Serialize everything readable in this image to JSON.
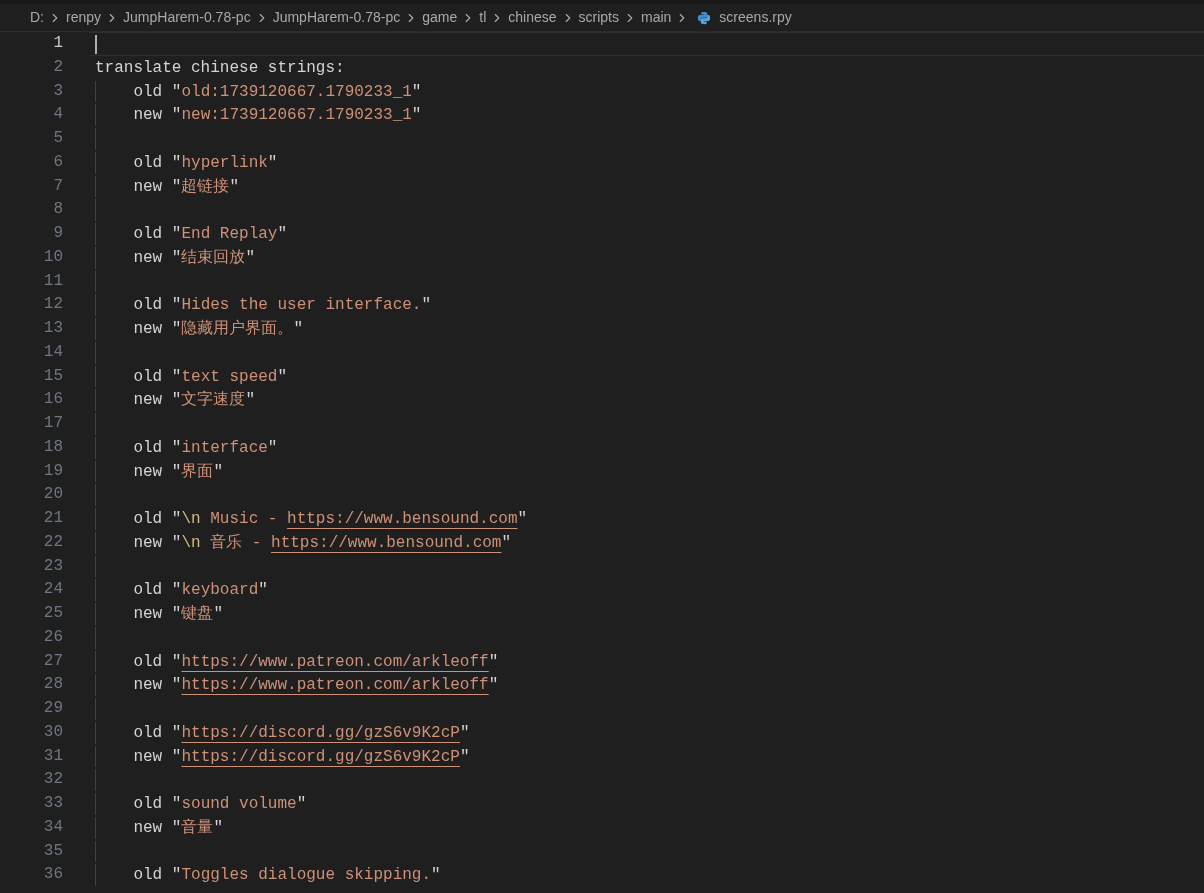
{
  "breadcrumb": [
    {
      "kind": "folder",
      "label": "D:"
    },
    {
      "kind": "folder",
      "label": "renpy"
    },
    {
      "kind": "folder",
      "label": "JumpHarem-0.78-pc"
    },
    {
      "kind": "folder",
      "label": "JumpHarem-0.78-pc"
    },
    {
      "kind": "folder",
      "label": "game"
    },
    {
      "kind": "folder",
      "label": "tl"
    },
    {
      "kind": "folder",
      "label": "chinese"
    },
    {
      "kind": "folder",
      "label": "scripts"
    },
    {
      "kind": "folder",
      "label": "main"
    },
    {
      "kind": "file",
      "label": "screens.rpy"
    }
  ],
  "lines": [
    {
      "number": "1",
      "current": true
    },
    {
      "number": "2",
      "current": false,
      "segments": [
        {
          "kind": "plain",
          "text": "translate chinese strings:"
        }
      ],
      "children": [
        {
          "number": "3",
          "current": false,
          "segments": [
            {
              "kind": "plain",
              "text": "old \""
            },
            {
              "kind": "string",
              "text": "old:1739120667.1790233_1"
            },
            {
              "kind": "plain",
              "text": "\""
            }
          ]
        },
        {
          "number": "4",
          "current": false,
          "segments": [
            {
              "kind": "plain",
              "text": "new \""
            },
            {
              "kind": "string",
              "text": "new:1739120667.1790233_1"
            },
            {
              "kind": "plain",
              "text": "\""
            }
          ]
        },
        {
          "number": "5",
          "current": false
        },
        {
          "number": "6",
          "current": false,
          "segments": [
            {
              "kind": "plain",
              "text": "old \""
            },
            {
              "kind": "string",
              "text": "hyperlink"
            },
            {
              "kind": "plain",
              "text": "\""
            }
          ]
        },
        {
          "number": "7",
          "current": false,
          "segments": [
            {
              "kind": "plain",
              "text": "new \""
            },
            {
              "kind": "string",
              "text": "超链接"
            },
            {
              "kind": "plain",
              "text": "\""
            }
          ]
        },
        {
          "number": "8",
          "current": false
        },
        {
          "number": "9",
          "current": false,
          "segments": [
            {
              "kind": "plain",
              "text": "old \""
            },
            {
              "kind": "string",
              "text": "End Replay"
            },
            {
              "kind": "plain",
              "text": "\""
            }
          ]
        },
        {
          "number": "10",
          "current": false,
          "segments": [
            {
              "kind": "plain",
              "text": "new \""
            },
            {
              "kind": "string",
              "text": "结束回放"
            },
            {
              "kind": "plain",
              "text": "\""
            }
          ]
        },
        {
          "number": "11",
          "current": false
        },
        {
          "number": "12",
          "current": false,
          "segments": [
            {
              "kind": "plain",
              "text": "old \""
            },
            {
              "kind": "string",
              "text": "Hides the user interface."
            },
            {
              "kind": "plain",
              "text": "\""
            }
          ]
        },
        {
          "number": "13",
          "current": false,
          "segments": [
            {
              "kind": "plain",
              "text": "new \""
            },
            {
              "kind": "string",
              "text": "隐藏用户界面。"
            },
            {
              "kind": "plain",
              "text": "\""
            }
          ]
        },
        {
          "number": "14",
          "current": false
        },
        {
          "number": "15",
          "current": false,
          "segments": [
            {
              "kind": "plain",
              "text": "old \""
            },
            {
              "kind": "string",
              "text": "text speed"
            },
            {
              "kind": "plain",
              "text": "\""
            }
          ]
        },
        {
          "number": "16",
          "current": false,
          "segments": [
            {
              "kind": "plain",
              "text": "new \""
            },
            {
              "kind": "string",
              "text": "文字速度"
            },
            {
              "kind": "plain",
              "text": "\""
            }
          ]
        },
        {
          "number": "17",
          "current": false
        },
        {
          "number": "18",
          "current": false,
          "segments": [
            {
              "kind": "plain",
              "text": "old \""
            },
            {
              "kind": "string",
              "text": "interface"
            },
            {
              "kind": "plain",
              "text": "\""
            }
          ]
        },
        {
          "number": "19",
          "current": false,
          "segments": [
            {
              "kind": "plain",
              "text": "new \""
            },
            {
              "kind": "string",
              "text": "界面"
            },
            {
              "kind": "plain",
              "text": "\""
            }
          ]
        },
        {
          "number": "20",
          "current": false
        },
        {
          "number": "21",
          "current": false,
          "segments": [
            {
              "kind": "plain",
              "text": "old \""
            },
            {
              "kind": "escape",
              "text": "\\n"
            },
            {
              "kind": "string",
              "text": " Music - "
            },
            {
              "kind": "link",
              "text": "https://www.bensound.com"
            },
            {
              "kind": "plain",
              "text": "\""
            }
          ]
        },
        {
          "number": "22",
          "current": false,
          "segments": [
            {
              "kind": "plain",
              "text": "new \""
            },
            {
              "kind": "escape",
              "text": "\\n"
            },
            {
              "kind": "string",
              "text": " 音乐 - "
            },
            {
              "kind": "link",
              "text": "https://www.bensound.com"
            },
            {
              "kind": "plain",
              "text": "\""
            }
          ]
        },
        {
          "number": "23",
          "current": false
        },
        {
          "number": "24",
          "current": false,
          "segments": [
            {
              "kind": "plain",
              "text": "old \""
            },
            {
              "kind": "string",
              "text": "keyboard"
            },
            {
              "kind": "plain",
              "text": "\""
            }
          ]
        },
        {
          "number": "25",
          "current": false,
          "segments": [
            {
              "kind": "plain",
              "text": "new \""
            },
            {
              "kind": "string",
              "text": "键盘"
            },
            {
              "kind": "plain",
              "text": "\""
            }
          ]
        },
        {
          "number": "26",
          "current": false
        },
        {
          "number": "27",
          "current": false,
          "segments": [
            {
              "kind": "plain",
              "text": "old \""
            },
            {
              "kind": "link",
              "text": "https://www.patreon.com/arkleoff"
            },
            {
              "kind": "plain",
              "text": "\""
            }
          ]
        },
        {
          "number": "28",
          "current": false,
          "segments": [
            {
              "kind": "plain",
              "text": "new \""
            },
            {
              "kind": "link",
              "text": "https://www.patreon.com/arkleoff"
            },
            {
              "kind": "plain",
              "text": "\""
            }
          ]
        },
        {
          "number": "29",
          "current": false
        },
        {
          "number": "30",
          "current": false,
          "segments": [
            {
              "kind": "plain",
              "text": "old \""
            },
            {
              "kind": "link",
              "text": "https://discord.gg/gzS6v9K2cP"
            },
            {
              "kind": "plain",
              "text": "\""
            }
          ]
        },
        {
          "number": "31",
          "current": false,
          "segments": [
            {
              "kind": "plain",
              "text": "new \""
            },
            {
              "kind": "link",
              "text": "https://discord.gg/gzS6v9K2cP"
            },
            {
              "kind": "plain",
              "text": "\""
            }
          ]
        },
        {
          "number": "32",
          "current": false
        },
        {
          "number": "33",
          "current": false,
          "segments": [
            {
              "kind": "plain",
              "text": "old \""
            },
            {
              "kind": "string",
              "text": "sound volume"
            },
            {
              "kind": "plain",
              "text": "\""
            }
          ]
        },
        {
          "number": "34",
          "current": false,
          "segments": [
            {
              "kind": "plain",
              "text": "new \""
            },
            {
              "kind": "string",
              "text": "音量"
            },
            {
              "kind": "plain",
              "text": "\""
            }
          ]
        },
        {
          "number": "35",
          "current": false
        },
        {
          "number": "36",
          "current": false,
          "segments": [
            {
              "kind": "plain",
              "text": "old \""
            },
            {
              "kind": "string",
              "text": "Toggles dialogue skipping."
            },
            {
              "kind": "plain",
              "text": "\""
            }
          ]
        }
      ]
    }
  ]
}
